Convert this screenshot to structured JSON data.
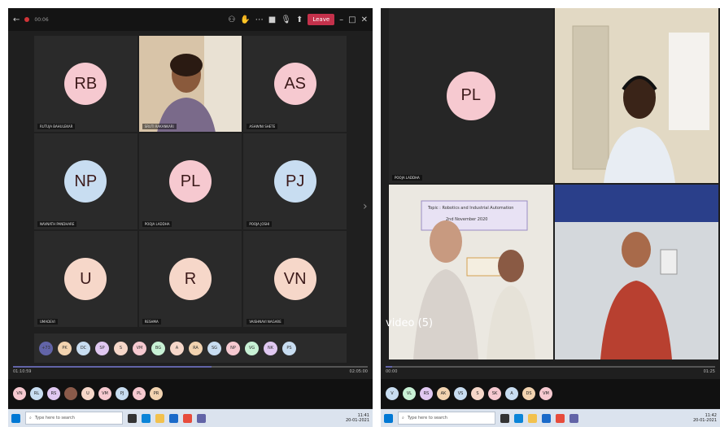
{
  "left": {
    "recording_time": "00:06",
    "leave_label": "Leave",
    "tiles": [
      {
        "initials": "RB",
        "name": "RUTUJA BAHULEKAR",
        "color": "#f6c9d0"
      },
      {
        "initials": "",
        "name": "SRUTI RAKANKARI",
        "color": ""
      },
      {
        "initials": "AS",
        "name": "ASHWINI SHETE",
        "color": "#f6c9d0"
      },
      {
        "initials": "NP",
        "name": "NAVNATH PANDHARE",
        "color": "#c8ddf1"
      },
      {
        "initials": "PL",
        "name": "POOJA LADDHA",
        "color": "#f6c9d0"
      },
      {
        "initials": "PJ",
        "name": "POOJA JOSHI",
        "color": "#c8ddf1"
      },
      {
        "initials": "U",
        "name": "UMADEVI",
        "color": "#f6d7c9"
      },
      {
        "initials": "R",
        "name": "RESHMA",
        "color": "#f6d7c9"
      },
      {
        "initials": "VN",
        "name": "VAISHNAVI NAGARE",
        "color": "#f6d7c9"
      }
    ],
    "strip": [
      {
        "initials": "+73",
        "color": "#6264a7"
      },
      {
        "initials": "PK",
        "color": "#f2d3b0"
      },
      {
        "initials": "DC",
        "color": "#c8ddf1"
      },
      {
        "initials": "SP",
        "color": "#e0c8f1"
      },
      {
        "initials": "S",
        "color": "#f6d7c9"
      },
      {
        "initials": "VM",
        "color": "#f6c9d0"
      },
      {
        "initials": "BG",
        "color": "#c8f1d5"
      },
      {
        "initials": "A",
        "color": "#f6d7c9"
      },
      {
        "initials": "RA",
        "color": "#f2d3b0"
      },
      {
        "initials": "SG",
        "color": "#c8ddf1"
      },
      {
        "initials": "NP",
        "color": "#f6c9d0"
      },
      {
        "initials": "VG",
        "color": "#c8f1d5"
      },
      {
        "initials": "NK",
        "color": "#e0c8f1"
      },
      {
        "initials": "PS",
        "color": "#c8ddf1"
      }
    ],
    "time_elapsed": "01:10:59",
    "time_total": "02:05:00",
    "progress": 0.56,
    "controls": [
      {
        "initials": "VN",
        "color": "#f6c9d0"
      },
      {
        "initials": "RL",
        "color": "#c8ddf1"
      },
      {
        "initials": "RS",
        "color": "#e0c8f1"
      },
      {
        "initials": "",
        "color": "#8a5a4a"
      },
      {
        "initials": "U",
        "color": "#f6d7c9"
      },
      {
        "initials": "VM",
        "color": "#f6c9d0"
      },
      {
        "initials": "PJ",
        "color": "#c8ddf1"
      },
      {
        "initials": "PL",
        "color": "#f6c9d0"
      },
      {
        "initials": "PR",
        "color": "#f2d3b0"
      }
    ],
    "taskbar": {
      "search_placeholder": "Type here to search",
      "time": "11:41",
      "date": "20-01-2021",
      "lang": "ENG"
    }
  },
  "right": {
    "tile_pl": {
      "initials": "PL",
      "name": "POOJA LADDHA",
      "color": "#f6c9d0"
    },
    "video_label": "video (5)",
    "banner_text": [
      "Topic : Robotics and Industrial Automation",
      "2nd November 2020"
    ],
    "time_elapsed": "00:00",
    "time_total": "01:25",
    "progress": 0.02,
    "controls": [
      {
        "initials": "V",
        "color": "#c8ddf1"
      },
      {
        "initials": "VL",
        "color": "#c8f1d5"
      },
      {
        "initials": "RS",
        "color": "#e0c8f1"
      },
      {
        "initials": "AK",
        "color": "#f2d3b0"
      },
      {
        "initials": "VS",
        "color": "#c8ddf1"
      },
      {
        "initials": "S",
        "color": "#f6d7c9"
      },
      {
        "initials": "SK",
        "color": "#f6c9d0"
      },
      {
        "initials": "A",
        "color": "#c8ddf1"
      },
      {
        "initials": "DS",
        "color": "#f2d3b0"
      },
      {
        "initials": "VM",
        "color": "#f6c9d0"
      }
    ],
    "taskbar": {
      "search_placeholder": "Type here to search",
      "time": "11:42",
      "date": "20-01-2021",
      "lang": "ENG"
    }
  }
}
